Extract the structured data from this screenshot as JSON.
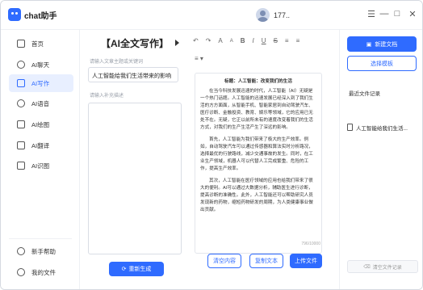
{
  "app": {
    "name": "chat助手"
  },
  "user": {
    "name": "177.."
  },
  "window_controls": [
    "☰",
    "—",
    "□",
    "✕"
  ],
  "sidebar": {
    "items": [
      {
        "label": "首页",
        "icon": "home-icon"
      },
      {
        "label": "AI聊天",
        "icon": "chat-icon"
      },
      {
        "label": "AI写作",
        "icon": "write-icon"
      },
      {
        "label": "AI语音",
        "icon": "voice-icon"
      },
      {
        "label": "AI绘图",
        "icon": "paint-icon"
      },
      {
        "label": "AI翻译",
        "icon": "translate-icon"
      },
      {
        "label": "AI识图",
        "icon": "image-recognize-icon"
      }
    ],
    "bottom": [
      {
        "label": "新手帮助",
        "icon": "help-icon"
      },
      {
        "label": "我的文件",
        "icon": "folder-icon"
      }
    ],
    "active_index": 2
  },
  "form": {
    "title": "【AI全文写作】",
    "topic_label": "请输入文章主题或关键词",
    "topic_value": "人工智能给我们生活带来的影响",
    "extra_label": "请输入补充描述",
    "regen_label": "重新生成"
  },
  "editor": {
    "toolbar": [
      "↶",
      "↷",
      "A",
      "A",
      "B",
      "I",
      "U",
      "S",
      "≡",
      "≡"
    ],
    "toolbar2": "≡ ▾",
    "doc_title": "标题：人工智能：改变我们的生活",
    "paragraphs": [
      "在当今科技发展迅速的时代，人工智能（AI）无疑是一个热门话题。人工智能的迅速发展已经深入到了我们生活的方方面面，从智能手机、智能家居到自动驾驶汽车、医疗诊断、金融投资、教育、娱乐等领域，它的应用已无处不在。无疑，它正以前所未有的速度改变着我们的生活方式，对我们的生产生活产生了深远的影响。",
      "首先，人工智能为我们带来了极大的生产效率。例如，自动驾驶汽车可以通过传感器和算法实时分析路况，选择最优的行驶路线，减少交通事故的发生。同时，在工业生产领域，机器人可以代替人工完成繁重、危险的工作，提高生产效率。",
      "其次，人工智能在医疗领域的应用也给我们带来了很大的便利。AI可以通过大数据分析，辅助医生进行诊断，提高诊断的准确性。此外，人工智能还可以帮助研究人员发现新的药物，缩短药物研发的周期，为人类健康事业做出贡献。"
    ],
    "word_count": "796/10000",
    "buttons": {
      "clear": "清空内容",
      "copy": "复制文本",
      "upload": "上传文件"
    }
  },
  "right_panel": {
    "new_doc": "新建文档",
    "choose_template": "选择模板",
    "recent_title": "最近文件记录",
    "recent_items": [
      "人工智能给我们生活..."
    ],
    "clear_records": "清空文件记录"
  },
  "colors": {
    "accent": "#2f6bff",
    "active_bg": "#e8efff"
  }
}
